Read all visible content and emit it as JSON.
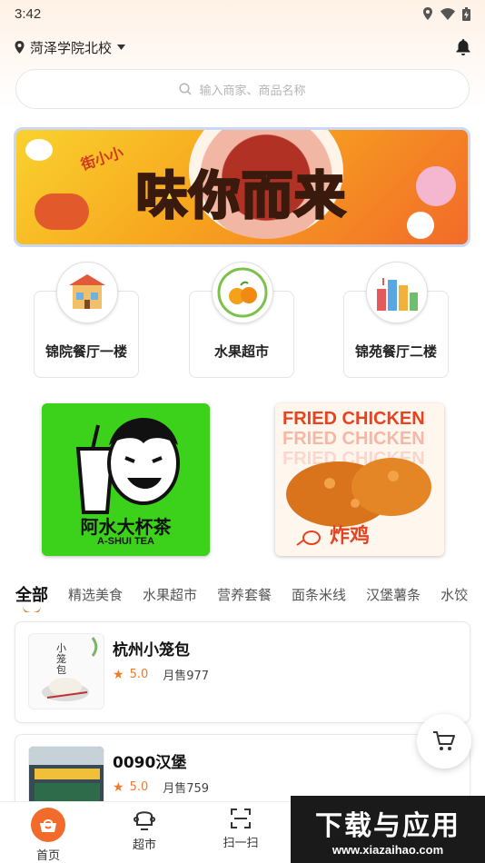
{
  "status_bar": {
    "time": "3:42"
  },
  "location": {
    "campus": "菏泽学院北校"
  },
  "search": {
    "placeholder": "输入商家、商品名称"
  },
  "banner": {
    "title": "味你而来",
    "tag": "街小小"
  },
  "categories": [
    {
      "label": "锦院餐厅一楼",
      "icon": "restaurant-building-icon"
    },
    {
      "label": "水果超市",
      "icon": "orange-fruit-icon"
    },
    {
      "label": "锦苑餐厅二楼",
      "icon": "city-buildings-icon"
    }
  ],
  "promos": [
    {
      "title": "阿水大杯茶",
      "subtitle": "A-SHUI TEA"
    },
    {
      "title": "FRIED CHICKEN",
      "subtitle": "炸鸡"
    }
  ],
  "tabs": [
    "全部",
    "精选美食",
    "水果超市",
    "营养套餐",
    "面条米线",
    "汉堡薯条",
    "水饺"
  ],
  "stores": [
    {
      "name": "杭州小笼包",
      "rating": "5.0",
      "sales": "月售977",
      "img_text": "小笼包"
    },
    {
      "name": "0090汉堡",
      "rating": "5.0",
      "sales": "月售759"
    }
  ],
  "bottom_nav": [
    {
      "label": "首页",
      "icon": "home-basket-icon"
    },
    {
      "label": "超市",
      "icon": "supermarket-icon"
    },
    {
      "label": "扫一扫",
      "icon": "scan-icon"
    }
  ],
  "watermark": {
    "big": "下载与应用",
    "small": "www.xiazaihao.com"
  },
  "colors": {
    "accent": "#f07a2c",
    "green": "#3cd21b"
  }
}
